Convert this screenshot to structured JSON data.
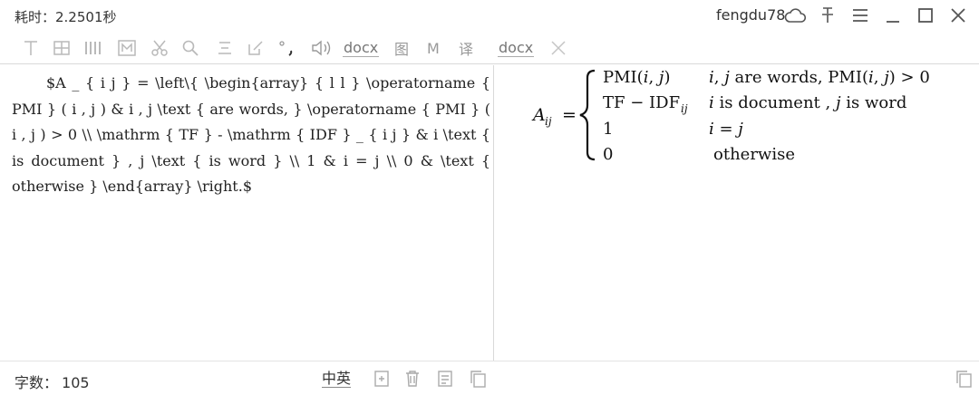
{
  "titlebar": {
    "elapsed": "耗时：2.2501秒",
    "user": "fengdu78"
  },
  "toolbar": {
    "docx_label_1": "docx",
    "tu_label": "图",
    "m_label": "M",
    "yi_label": "译",
    "docx_label_2": "docx"
  },
  "editor": {
    "latex_source": "$A _ { i j } = \\left\\{ \\begin{array} { l l } \\operatorname { PMI } ( i , j ) & i , j \\text { are words, } \\operatorname { PMI } ( i , j ) > 0 \\\\ \\mathrm { TF } - \\mathrm { IDF } _ { i j } & i \\text { is document } , j \\text { is word } \\\\ 1 & i = j \\\\ 0 & \\text { otherwise } \\end{array} \\right.$"
  },
  "preview": {
    "lhs_base": "A",
    "lhs_sub": "ij",
    "equals": "=",
    "rows": [
      {
        "left_a": "PMI(",
        "left_i": "i",
        "left_comma": ", ",
        "left_j": "j",
        "left_close": ")",
        "right_a": "i",
        "right_b": ", ",
        "right_c": "j",
        "right_d": " are words,  PMI(",
        "right_e": "i",
        "right_f": ", ",
        "right_g": "j",
        "right_h": ") > 0"
      },
      {
        "left_text": "TF − IDF",
        "left_sub": "ij",
        "right_a": "i",
        "right_d": " is document , ",
        "right_c": "j",
        "right_h": " is word"
      },
      {
        "left_text": "1",
        "right_a": "i",
        "right_d": " = ",
        "right_c": "j"
      },
      {
        "left_text": "0",
        "right_d": "otherwise"
      }
    ]
  },
  "statusbar": {
    "count_label": "字数：",
    "count_value": "105",
    "lang_label": "中英"
  },
  "colors": {
    "border": "#d9d9d9",
    "icon_gray": "#b9b9b9",
    "text": "#333333"
  }
}
